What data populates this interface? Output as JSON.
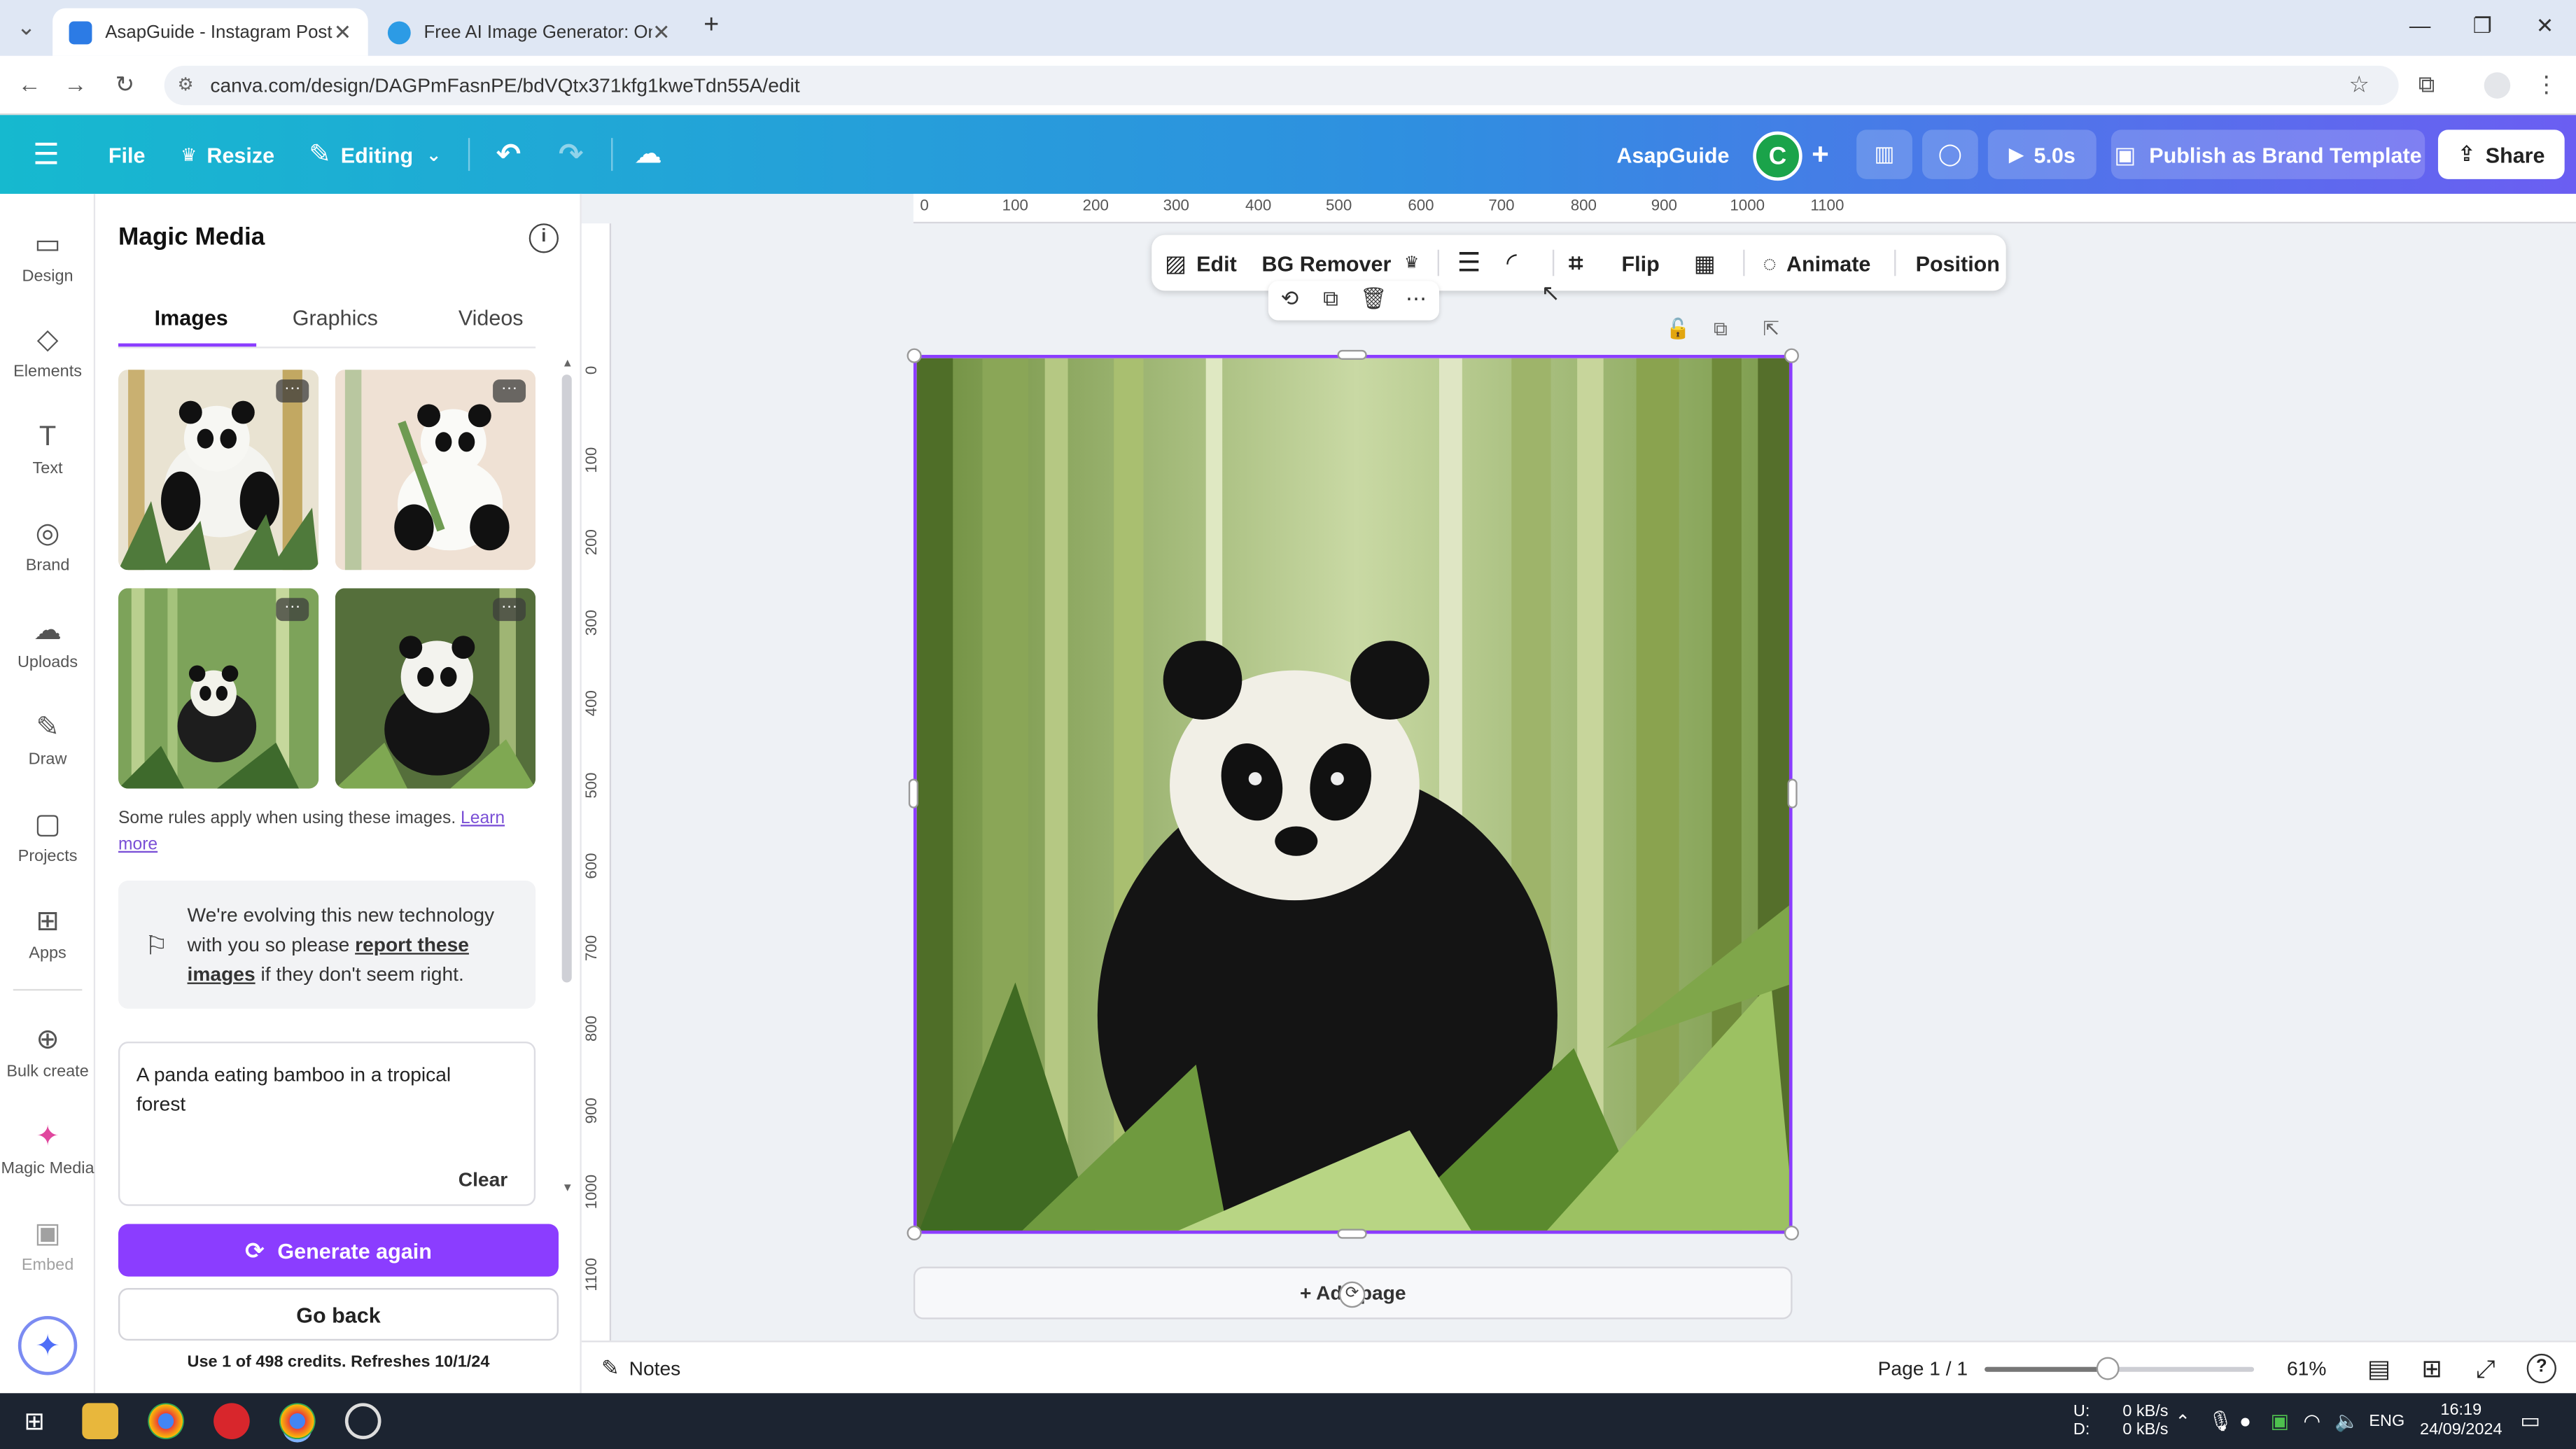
{
  "browser": {
    "tabs": [
      {
        "title": "AsapGuide - Instagram Post",
        "active": true,
        "close": "✕"
      },
      {
        "title": "Free AI Image Generator: Onlin",
        "active": false,
        "close": "✕"
      }
    ],
    "new_tab": "+",
    "url": "canva.com/design/DAGPmFasnPE/bdVQtx371kfg1kweTdn55A/edit"
  },
  "header": {
    "file": "File",
    "resize": "Resize",
    "editing": "Editing",
    "brand_name": "AsapGuide",
    "avatar_letter": "C",
    "plus": "+",
    "play_duration": "5.0s",
    "publish": "Publish as Brand Template",
    "share": "Share"
  },
  "rail": {
    "items": [
      {
        "label": "Design",
        "icon": "▭"
      },
      {
        "label": "Elements",
        "icon": "◇"
      },
      {
        "label": "Text",
        "icon": "T"
      },
      {
        "label": "Brand",
        "icon": "◎"
      },
      {
        "label": "Uploads",
        "icon": "☁"
      },
      {
        "label": "Draw",
        "icon": "✎"
      },
      {
        "label": "Projects",
        "icon": "▢"
      },
      {
        "label": "Apps",
        "icon": "⊞"
      },
      {
        "label": "Bulk create",
        "icon": "⊕"
      },
      {
        "label": "Magic Media",
        "icon": "✦"
      },
      {
        "label": "Embed",
        "icon": "▣"
      }
    ]
  },
  "panel": {
    "title": "Magic Media",
    "tabs": [
      "Images",
      "Graphics",
      "Videos"
    ],
    "rules_text": "Some rules apply when using these images.",
    "rules_link": "Learn more",
    "notice_pre": "We're evolving this new technology with you so please",
    "notice_link": "report these images",
    "notice_post": "if they don't seem right.",
    "prompt": "A panda eating bamboo in a tropical forest",
    "clear": "Clear",
    "generate": "Generate again",
    "back": "Go back",
    "credits": "Use 1 of 498 credits. Refreshes 10/1/24",
    "more": "···"
  },
  "ruler": {
    "top": [
      "0",
      "100",
      "200",
      "300",
      "400",
      "500",
      "600",
      "700",
      "800",
      "900",
      "1000",
      "1100"
    ],
    "left": [
      "0",
      "100",
      "200",
      "300",
      "400",
      "500",
      "600",
      "700",
      "800",
      "900",
      "1000",
      "1100"
    ]
  },
  "toolbar": {
    "edit": "Edit",
    "bg_remover": "BG Remover",
    "flip": "Flip",
    "animate": "Animate",
    "position": "Position"
  },
  "canvas": {
    "add_page": "+ Add page"
  },
  "footer": {
    "notes": "Notes",
    "page": "Page 1 / 1",
    "zoom": "61%",
    "zoom_level": 0.46,
    "help": "?"
  },
  "taskbar": {
    "net_up_label": "U:",
    "net_down_label": "D:",
    "net_up": "0 kB/s",
    "net_down": "0 kB/s",
    "lang": "ENG",
    "time": "16:19",
    "date": "24/09/2024"
  },
  "colors": {
    "accent": "#8b3dff",
    "header_start": "#16b9cf",
    "header_end": "#6b5ef2"
  }
}
